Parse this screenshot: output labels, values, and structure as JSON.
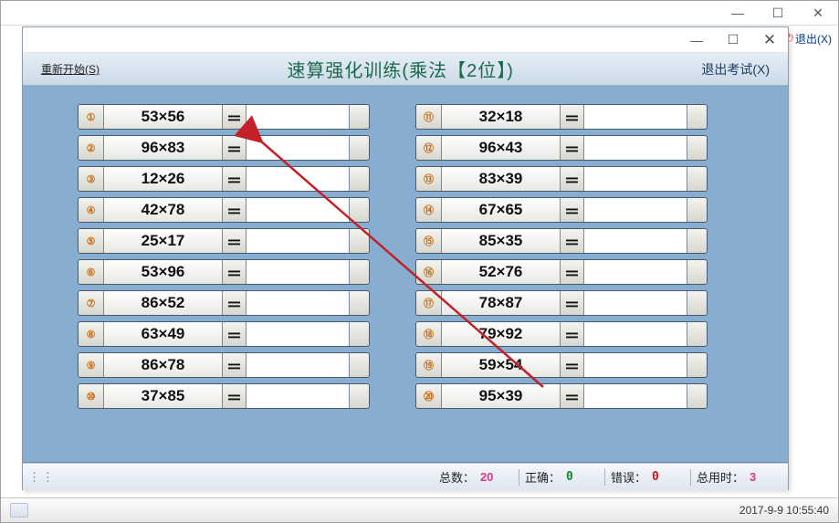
{
  "outer": {
    "exit_label": "退出(X)"
  },
  "header": {
    "restart_label": "重新开始(S)",
    "title": "速算强化训练(乘法【2位】)",
    "exit_label": "退出考试(X)"
  },
  "equals": "＝",
  "problems_left": [
    {
      "n": "①",
      "expr": "53×56"
    },
    {
      "n": "②",
      "expr": "96×83"
    },
    {
      "n": "③",
      "expr": "12×26"
    },
    {
      "n": "④",
      "expr": "42×78"
    },
    {
      "n": "⑤",
      "expr": "25×17"
    },
    {
      "n": "⑥",
      "expr": "53×96"
    },
    {
      "n": "⑦",
      "expr": "86×52"
    },
    {
      "n": "⑧",
      "expr": "63×49"
    },
    {
      "n": "⑨",
      "expr": "86×78"
    },
    {
      "n": "⑩",
      "expr": "37×85"
    }
  ],
  "problems_right": [
    {
      "n": "⑪",
      "expr": "32×18"
    },
    {
      "n": "⑫",
      "expr": "96×43"
    },
    {
      "n": "⑬",
      "expr": "83×39"
    },
    {
      "n": "⑭",
      "expr": "67×65"
    },
    {
      "n": "⑮",
      "expr": "85×35"
    },
    {
      "n": "⑯",
      "expr": "52×76"
    },
    {
      "n": "⑰",
      "expr": "78×87"
    },
    {
      "n": "⑱",
      "expr": "79×92"
    },
    {
      "n": "⑲",
      "expr": "59×54"
    },
    {
      "n": "⑳",
      "expr": "95×39"
    }
  ],
  "status": {
    "total_label": "总数：",
    "total_value": "20",
    "correct_label": "正确：",
    "correct_value": "0",
    "wrong_label": "错误：",
    "wrong_value": "0",
    "time_label": "总用时：",
    "time_value": "3"
  },
  "taskbar": {
    "datetime": "2017-9-9 10:55:40"
  }
}
